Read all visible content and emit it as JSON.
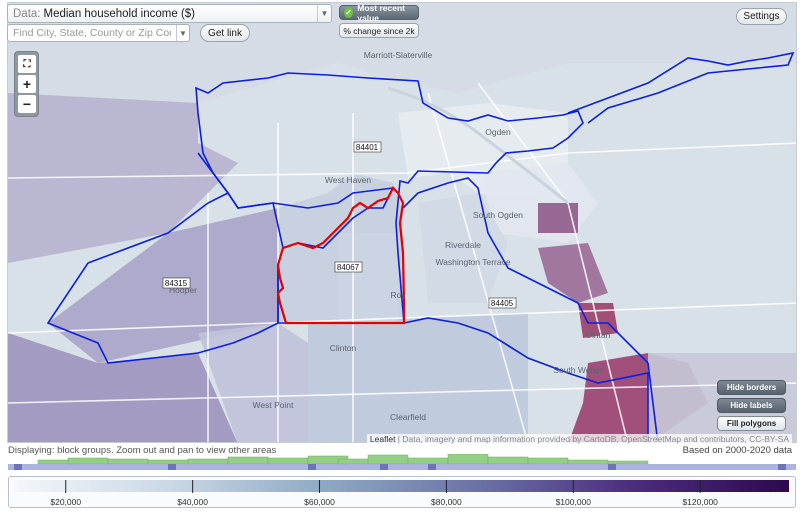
{
  "data_select": {
    "label": "Data:",
    "value": "Median household income ($)"
  },
  "search": {
    "placeholder": "Find City, State, County or Zip Code"
  },
  "buttons": {
    "get_link": "Get link",
    "settings": "Settings",
    "most_recent": "Most recent value",
    "percent_change": "% change since 2k",
    "hide_borders": "Hide borders",
    "hide_labels": "Hide labels",
    "fill_polygons": "Fill polygons"
  },
  "zoom": {
    "full_extent": "⛶",
    "in": "+",
    "out": "−"
  },
  "map": {
    "place_labels": [
      {
        "text": "Marriott-Slaterville"
      },
      {
        "text": "Ogden"
      },
      {
        "text": "West Haven"
      },
      {
        "text": "South Ogden"
      },
      {
        "text": "Riverdale"
      },
      {
        "text": "Washington Terrace"
      },
      {
        "text": "Hooper"
      },
      {
        "text": "Roy"
      },
      {
        "text": "Clinton"
      },
      {
        "text": "Uintah"
      },
      {
        "text": "South Weber"
      },
      {
        "text": "West Point"
      },
      {
        "text": "Clearfield"
      }
    ],
    "zip_labels": [
      "84401",
      "84067",
      "84315",
      "84405"
    ],
    "colors": {
      "zip_border": "#0a1fe0",
      "city_border": "#e60000",
      "base": "#d9e1e8"
    }
  },
  "attribution": {
    "leaflet": "Leaflet",
    "text": " | Data, imagery and map information provided by CartoDB, OpenStreetMap and contributors, CC-BY-SA"
  },
  "status": {
    "displaying": "Displaying: block groups. Zoom out and pan to view other areas",
    "based_on": "Based on 2000-2020 data"
  },
  "legend": {
    "ticks": [
      "$20,000",
      "$40,000",
      "$60,000",
      "$80,000",
      "$100,000",
      "$120,000"
    ],
    "tick_values": [
      20000,
      40000,
      60000,
      80000,
      100000,
      120000
    ],
    "min": 12000,
    "max": 134000,
    "gradient": [
      "#f4f6f9",
      "#c9d8e6",
      "#8ea9c4",
      "#6a72a6",
      "#4b2c7d",
      "#2d0a4f"
    ]
  }
}
